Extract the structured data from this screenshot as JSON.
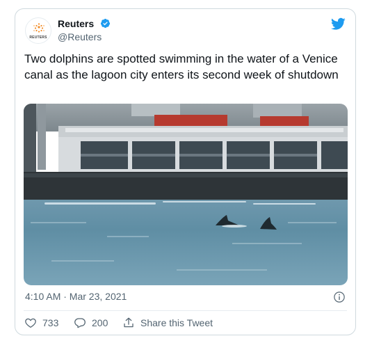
{
  "author": {
    "name": "Reuters",
    "handle": "@Reuters",
    "avatar_label": "REUTERS",
    "verified": true
  },
  "tweet": {
    "text": "Two dolphins are spotted swimming in the water of a Venice canal as the lagoon city enters its second week of shutdown",
    "timestamp": "4:10 AM · Mar 23, 2021"
  },
  "actions": {
    "like_count": "733",
    "reply_count": "200",
    "share_label": "Share this Tweet"
  },
  "icons": {
    "platform": "twitter-bird-icon",
    "verified": "verified-badge-icon",
    "info": "info-icon",
    "like": "heart-icon",
    "reply": "reply-bubble-icon",
    "share": "share-icon"
  },
  "colors": {
    "brand": "#1d9bf0",
    "reuters_orange": "#f28c28",
    "muted_text": "#536471",
    "border": "#cfd9de"
  }
}
